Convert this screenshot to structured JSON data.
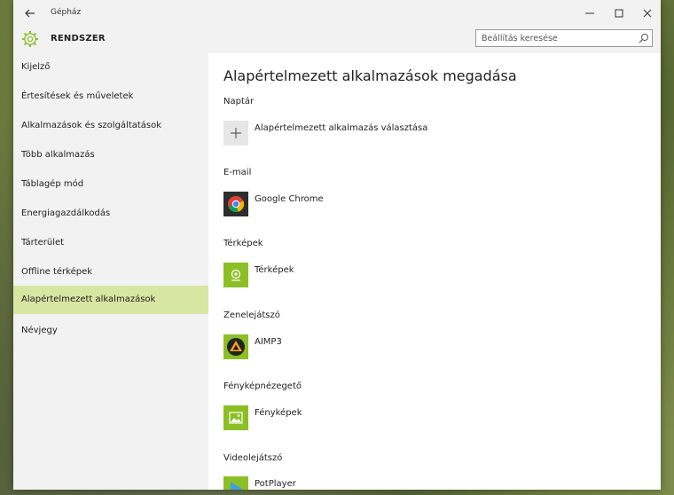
{
  "window": {
    "title": "Gépház"
  },
  "header": {
    "app_name": "RENDSZER"
  },
  "search": {
    "placeholder": "Beállítás keresése"
  },
  "sidebar": {
    "items": [
      {
        "label": "Kijelző"
      },
      {
        "label": "Értesítések és műveletek"
      },
      {
        "label": "Alkalmazások és szolgáltatások"
      },
      {
        "label": "Több alkalmazás"
      },
      {
        "label": "Táblagép mód"
      },
      {
        "label": "Energiagazdálkodás"
      },
      {
        "label": "Tárterület"
      },
      {
        "label": "Offline térképek"
      },
      {
        "label": "Alapértelmezett alkalmazások"
      },
      {
        "label": "Névjegy"
      }
    ]
  },
  "main": {
    "title": "Alapértelmezett alkalmazások megadása",
    "sections": [
      {
        "label": "Naptár",
        "app": "Alapértelmezett alkalmazás választása",
        "icon": "plus-icon"
      },
      {
        "label": "E-mail",
        "app": "Google Chrome",
        "icon": "chrome-icon"
      },
      {
        "label": "Térképek",
        "app": "Térképek",
        "icon": "maps-icon"
      },
      {
        "label": "Zenelejátszó",
        "app": "AIMP3",
        "icon": "aimp-icon"
      },
      {
        "label": "Fényképnézegető",
        "app": "Fényképek",
        "icon": "photos-icon"
      },
      {
        "label": "Videolejátszó",
        "app": "PotPlayer",
        "icon": "potplayer-icon"
      }
    ]
  },
  "colors": {
    "accent": "#8cbf26",
    "nav_active": "#d7e6a2"
  }
}
